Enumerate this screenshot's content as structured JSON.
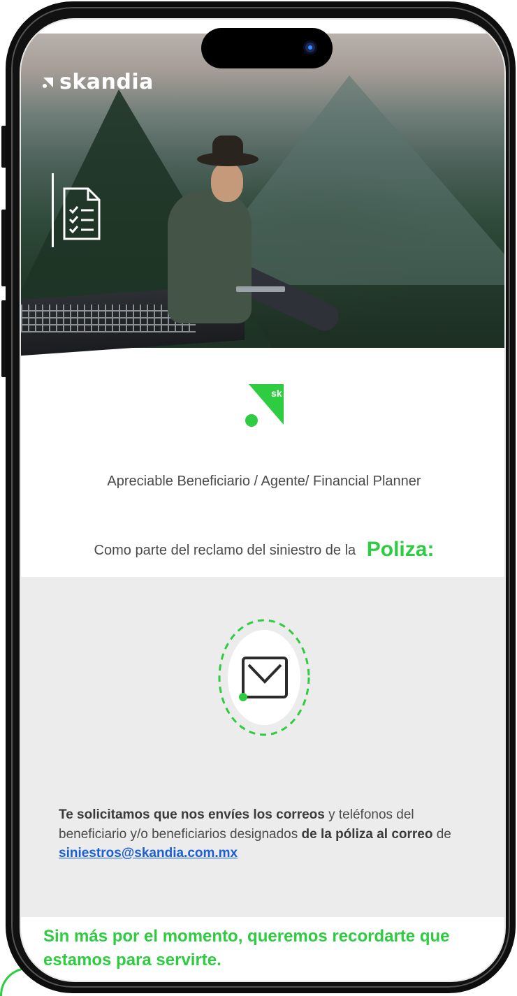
{
  "brand": {
    "name": "skandia",
    "mark_letters": "sk",
    "accent_color": "#2ecc40"
  },
  "email": {
    "greeting": "Apreciable Beneficiario / Agente/ Financial Planner",
    "claim_intro": "Como parte del reclamo del siniestro de la",
    "policy_label": "Poliza:",
    "request_bold_1": "Te solicitamos que nos envíes los correos",
    "request_text_1": " y teléfonos del beneficiario y/o beneficiarios designados ",
    "request_bold_2": "de la póliza al correo",
    "request_text_2": " de ",
    "contact_email": "siniestros@skandia.com.mx",
    "closing": "Sin más por el momento, queremos recordarte que estamos para servirte."
  },
  "icons": {
    "hero_icon": "document-checklist-icon",
    "mail_icon": "envelope-icon",
    "brand_icon": "skandia-logo-icon"
  }
}
